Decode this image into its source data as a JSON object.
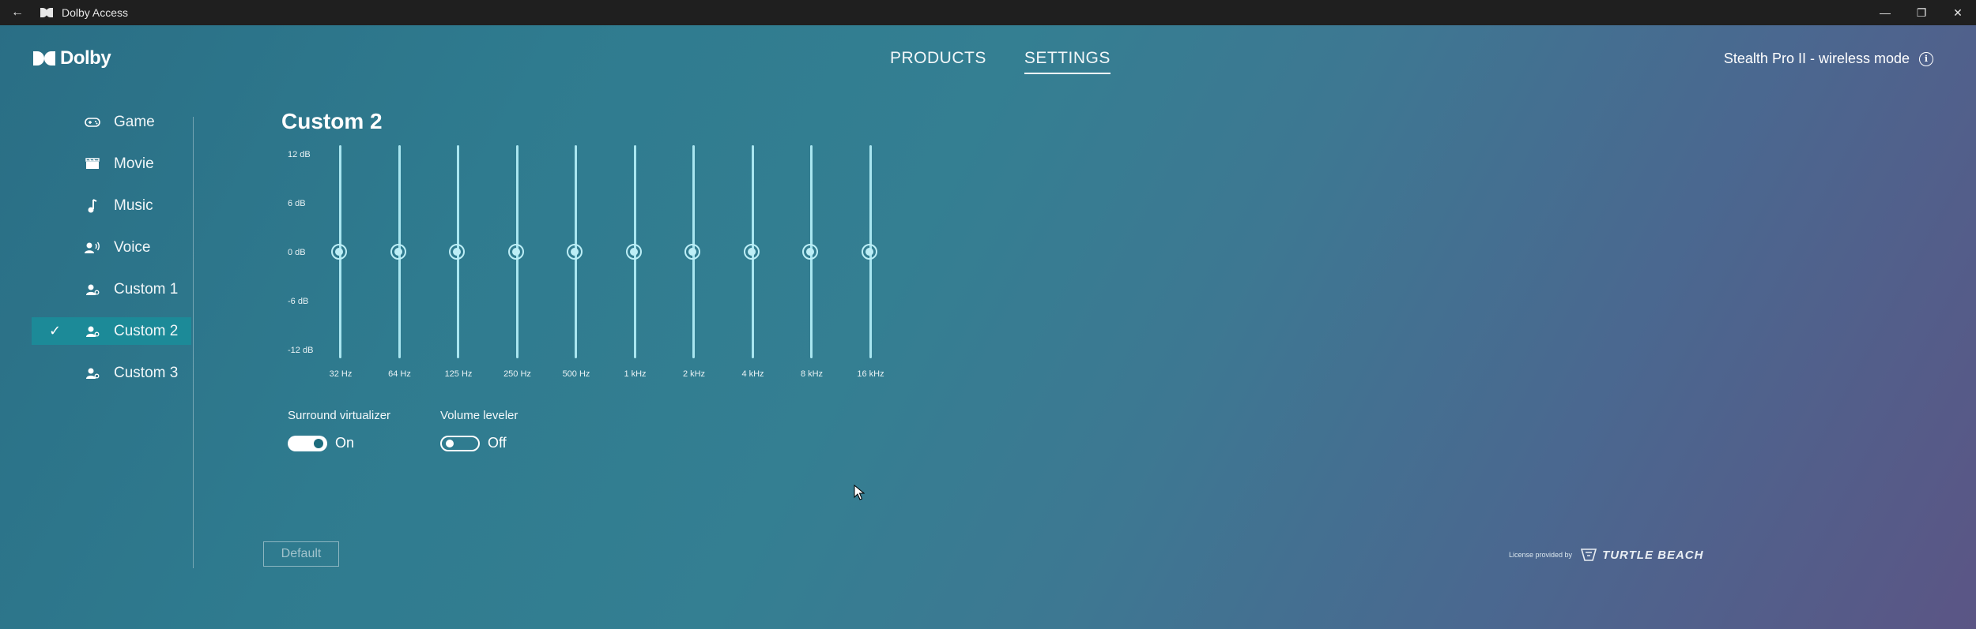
{
  "titlebar": {
    "title": "Dolby Access",
    "back_glyph": "←",
    "minimize_glyph": "—",
    "restore_glyph": "❐",
    "close_glyph": "✕"
  },
  "header": {
    "brand": "Dolby",
    "tabs": [
      {
        "label": "PRODUCTS",
        "active": false
      },
      {
        "label": "SETTINGS",
        "active": true
      }
    ],
    "device_name": "Stealth Pro II - wireless mode",
    "info_glyph": "i"
  },
  "sidebar": {
    "items": [
      {
        "label": "Game",
        "icon": "gamepad-icon",
        "active": false
      },
      {
        "label": "Movie",
        "icon": "clapperboard-icon",
        "active": false
      },
      {
        "label": "Music",
        "icon": "music-note-icon",
        "active": false
      },
      {
        "label": "Voice",
        "icon": "voice-icon",
        "active": false
      },
      {
        "label": "Custom 1",
        "icon": "person-icon",
        "active": false
      },
      {
        "label": "Custom 2",
        "icon": "person-icon",
        "active": true
      },
      {
        "label": "Custom 3",
        "icon": "person-icon",
        "active": false
      }
    ],
    "check_glyph": "✓"
  },
  "main": {
    "title": "Custom 2",
    "eq": {
      "db_labels": [
        "12 dB",
        "6 dB",
        "0 dB",
        "-6 dB",
        "-12 dB"
      ],
      "range_db": [
        -12,
        12
      ],
      "bands": [
        {
          "label": "32 Hz",
          "gain_db": 0
        },
        {
          "label": "64 Hz",
          "gain_db": 0
        },
        {
          "label": "125 Hz",
          "gain_db": 0
        },
        {
          "label": "250 Hz",
          "gain_db": 0
        },
        {
          "label": "500 Hz",
          "gain_db": 0
        },
        {
          "label": "1 kHz",
          "gain_db": 0
        },
        {
          "label": "2 kHz",
          "gain_db": 0
        },
        {
          "label": "4 kHz",
          "gain_db": 0
        },
        {
          "label": "8 kHz",
          "gain_db": 0
        },
        {
          "label": "16 kHz",
          "gain_db": 0
        }
      ]
    },
    "toggles": {
      "surround": {
        "title": "Surround virtualizer",
        "state": "On",
        "on": true
      },
      "leveler": {
        "title": "Volume leveler",
        "state": "Off",
        "on": false
      }
    },
    "default_button": "Default"
  },
  "footer": {
    "license_text": "License provided by",
    "partner": "TURTLE BEACH"
  }
}
